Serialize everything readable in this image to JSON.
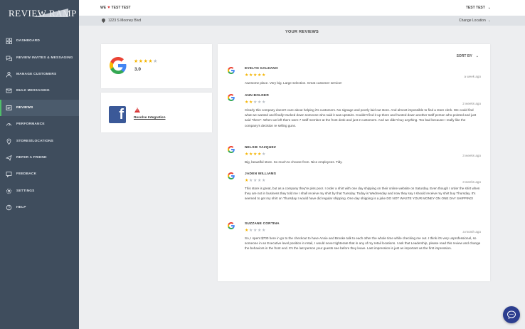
{
  "app": {
    "logo_text": "REVIEW RAMP"
  },
  "sidebar": {
    "items": [
      {
        "label": "DASHBOARD",
        "icon": "grid-icon",
        "active": false
      },
      {
        "label": "REVIEW INVITES & MESSAGING",
        "icon": "chat-bubbles-icon",
        "active": false
      },
      {
        "label": "MANAGE CUSTOMERS",
        "icon": "customers-icon",
        "active": false
      },
      {
        "label": "BULK MESSAGING",
        "icon": "bulk-message-icon",
        "active": false
      },
      {
        "label": "REVIEWS",
        "icon": "reviews-icon",
        "active": true
      },
      {
        "label": "PERFORMANCE",
        "icon": "performance-icon",
        "active": false
      },
      {
        "label": "STORES/LOCATIONS",
        "icon": "map-pin-icon",
        "active": false
      },
      {
        "label": "REFER A FRIEND",
        "icon": "refer-icon",
        "active": false
      },
      {
        "label": "FEEDBACK",
        "icon": "feedback-icon",
        "active": false
      },
      {
        "label": "SETTINGS",
        "icon": "gear-icon",
        "active": false
      },
      {
        "label": "HELP",
        "icon": "help-icon",
        "active": false
      }
    ]
  },
  "topbar": {
    "greeting_prefix": "WE",
    "greeting_suffix": "TEST TEST",
    "user_label": "TEST TEST"
  },
  "location": {
    "address": "1223 S Mooney Blvd",
    "change_label": "Change Location"
  },
  "page": {
    "title": "YOUR REVIEWS"
  },
  "google_card": {
    "rating": "3.0",
    "stars": 4
  },
  "facebook_card": {
    "resolve_label": "Resolve Integration"
  },
  "reviews_panel": {
    "sort_label": "SORT BY",
    "reviews": [
      {
        "name": "EVELYN GALEANO",
        "date": "a week ago",
        "stars": 5,
        "text": "Awesome place. Very big. Large selection. Great customer service!"
      },
      {
        "name": "ANN BOLDER",
        "date": "2 weeks ago",
        "stars": 2,
        "text": "Clearly this company doesn't care about helping it's customers. No signage and poorly laid out store. And almost impossible to find a store clerk. We could find what we wanted and finally tracked down someone who said it was upstairs. Couldn't find it up there and hunted down another staff person who pointed and just said \"there\". When we left there were 7 staff member at the front desk and just 2 customers. And we didn't buy anything. Too bad because I really like the company's decision re selling guns."
      },
      {
        "name": "NELSIE VAZQUEZ",
        "date": "3 weeks ago",
        "stars": 4,
        "text": "Big, beautiful store. So much to choose from. Nice employees. Tidy."
      },
      {
        "name": "JADEN WILLIAMS",
        "date": "3 weeks ago",
        "stars": 1,
        "text": "This store is great, but as a company they're piss poor. I order a shirt with one day shipping on their online website on Saturday. Even though I order the shirt when they are not in business they told me I shall receive my shirt by that Tuesday. Today is Wednesday and now they say I should receive my shirt buy Thursday. It's seemed to get my shirt on Thursday I would have did regular shipping. One day shipping is a joke DO NOT WASTE YOUR MONEY ON ONE DAY SHIPPING!"
      },
      {
        "name": "SUZZANE CORTINA",
        "date": "a month ago",
        "stars": 1,
        "text": "So, I spent $700 here in go to the checkout to have Annie and Brooke talk to each other the whole time while checking me out. I think it's very unprofessional, so someone in an Executive level position in retail, I would never tighterate that in any of my retail locations. I ask that Leadership, please read this review and change the behaviors in the front end. It's the last person your guests see before they leave. Last impression is just as important as the first impression."
      }
    ]
  },
  "colors": {
    "sidebar_bg": "#3f4d5d",
    "accent_active": "#4fbe6a",
    "star_on": "#f4b400",
    "star_off": "#b8bec5",
    "facebook": "#3b5998",
    "chat_button": "#2c3e8f"
  }
}
